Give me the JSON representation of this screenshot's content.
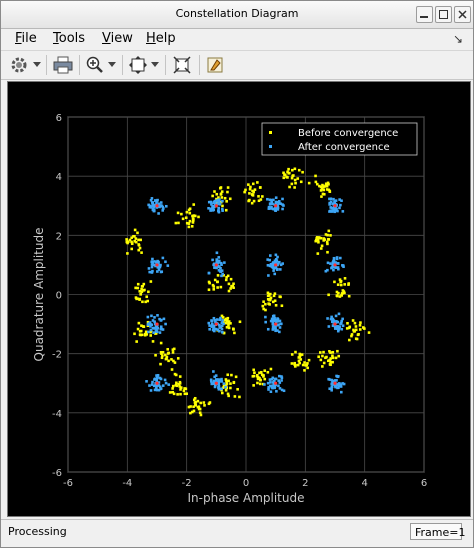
{
  "window": {
    "title": "Constellation Diagram"
  },
  "menu": {
    "file": {
      "key": "F",
      "rest": "ile"
    },
    "tools": {
      "key": "T",
      "rest": "ools"
    },
    "view": {
      "key": "V",
      "rest": "iew"
    },
    "help": {
      "key": "H",
      "rest": "elp"
    }
  },
  "toolbar": {
    "icons": [
      "gear-icon",
      "print-icon",
      "zoom-in-icon",
      "pan-icon",
      "scale-axes-icon",
      "highlight-icon"
    ]
  },
  "status": {
    "text": "Processing",
    "frame": "Frame=1"
  },
  "colors": {
    "before": "#ffff00",
    "after": "#3da5f5",
    "background": "#000000",
    "grid": "#4a4a4a",
    "axis_text": "#c8c8c8"
  },
  "chart_data": {
    "type": "scatter",
    "title": "",
    "xlabel": "In-phase Amplitude",
    "ylabel": "Quadrature Amplitude",
    "xlim": [
      -6,
      6
    ],
    "ylim": [
      -6,
      6
    ],
    "xticks": [
      -6,
      -4,
      -2,
      0,
      2,
      4,
      6
    ],
    "yticks": [
      -6,
      -4,
      -2,
      0,
      2,
      4,
      6
    ],
    "grid": true,
    "legend_position": "top-right",
    "constellation_points": [
      [
        -3,
        3
      ],
      [
        -1,
        3
      ],
      [
        1,
        3
      ],
      [
        3,
        3
      ],
      [
        -3,
        1
      ],
      [
        -1,
        1
      ],
      [
        1,
        1
      ],
      [
        3,
        1
      ],
      [
        -3,
        -1
      ],
      [
        -1,
        -1
      ],
      [
        1,
        -1
      ],
      [
        3,
        -1
      ],
      [
        -3,
        -3
      ],
      [
        -1,
        -3
      ],
      [
        1,
        -3
      ],
      [
        3,
        -3
      ]
    ],
    "series": [
      {
        "name": "Before convergence",
        "arc_centers": [
          [
            2.6,
            3.6
          ],
          [
            1.5,
            4.0
          ],
          [
            0.3,
            3.4
          ],
          [
            -0.9,
            3.3
          ],
          [
            -1.9,
            2.6
          ],
          [
            -3.8,
            1.8
          ],
          [
            -3.4,
            0.0
          ],
          [
            -3.4,
            -1.3
          ],
          [
            -2.6,
            -2.1
          ],
          [
            -2.3,
            -3.1
          ],
          [
            -1.6,
            -3.8
          ],
          [
            -0.6,
            -3.1
          ],
          [
            0.4,
            -2.8
          ],
          [
            1.8,
            -2.3
          ],
          [
            2.8,
            -2.2
          ],
          [
            3.7,
            -1.2
          ],
          [
            3.2,
            0.2
          ],
          [
            2.6,
            1.8
          ],
          [
            0.8,
            -0.2
          ],
          [
            -0.6,
            -1.0
          ],
          [
            -0.8,
            0.4
          ]
        ]
      },
      {
        "name": "After convergence",
        "cluster_centers": [
          [
            -3,
            3
          ],
          [
            -1,
            3
          ],
          [
            1,
            3
          ],
          [
            3,
            3
          ],
          [
            -3,
            1
          ],
          [
            -1,
            1
          ],
          [
            1,
            1
          ],
          [
            3,
            1
          ],
          [
            -3,
            -1
          ],
          [
            -1,
            -1
          ],
          [
            1,
            -1
          ],
          [
            3,
            -1
          ],
          [
            -3,
            -3
          ],
          [
            -1,
            -3
          ],
          [
            1,
            -3
          ],
          [
            3,
            -3
          ]
        ]
      }
    ]
  }
}
